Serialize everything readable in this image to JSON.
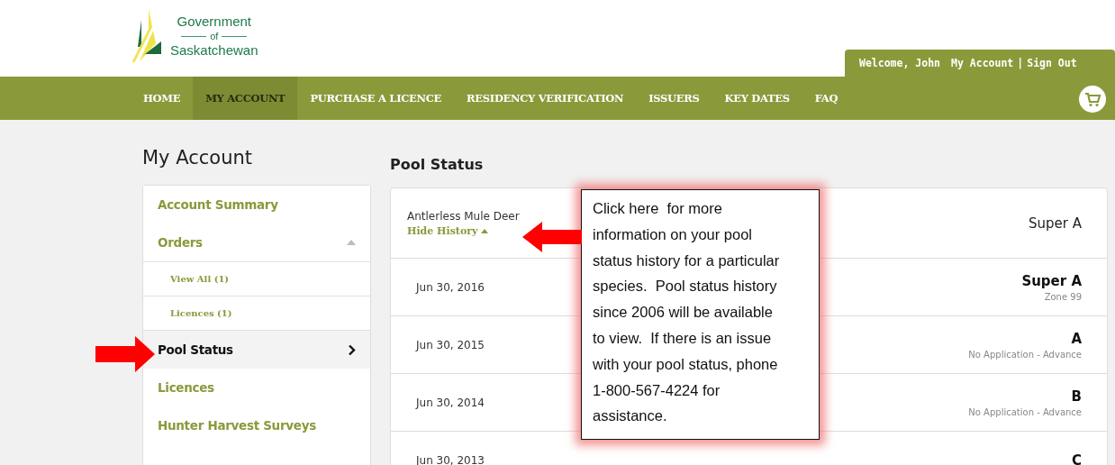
{
  "logo": {
    "line1": "Government",
    "line2": "of",
    "line3": "Saskatchewan"
  },
  "user_bar": {
    "welcome": "Welcome, John",
    "account_link": "My Account",
    "separator": "|",
    "sign_out": "Sign Out"
  },
  "nav": [
    {
      "label": "HOME",
      "selected": false
    },
    {
      "label": "MY ACCOUNT",
      "selected": true
    },
    {
      "label": "PURCHASE A LICENCE",
      "selected": false
    },
    {
      "label": "RESIDENCY VERIFICATION",
      "selected": false
    },
    {
      "label": "ISSUERS",
      "selected": false
    },
    {
      "label": "KEY DATES",
      "selected": false
    },
    {
      "label": "FAQ",
      "selected": false
    }
  ],
  "sidebar": {
    "title": "My Account",
    "items": [
      {
        "label": "Account Summary",
        "kind": "main",
        "selected": false
      },
      {
        "label": "Orders",
        "kind": "main",
        "selected": false,
        "expanded": true,
        "children": [
          {
            "label": "View All (1)",
            "kind": "sub",
            "selected": false
          },
          {
            "label": "Licences (1)",
            "kind": "sub",
            "selected": false
          }
        ]
      },
      {
        "label": "Pool Status",
        "kind": "main",
        "selected": true
      },
      {
        "label": "Licences",
        "kind": "main",
        "selected": false
      },
      {
        "label": "Hunter Harvest Surveys",
        "kind": "main",
        "selected": false
      }
    ]
  },
  "pool_status": {
    "title": "Pool Status",
    "species": "Antlerless Mule Deer",
    "toggle": {
      "label": "Hide History",
      "expanded": true
    },
    "current": "Super A",
    "history": [
      {
        "date": "Jun 30, 2016",
        "status": "Super A",
        "note": "Zone 99"
      },
      {
        "date": "Jun 30, 2015",
        "status": "A",
        "note": "No Application - Advance"
      },
      {
        "date": "Jun 30, 2014",
        "status": "B",
        "note": "No Application - Advance"
      },
      {
        "date": "Jun 30, 2013",
        "status": "C"
      }
    ]
  },
  "callout": {
    "text": "Click here  for more information on your pool status history for a particular species.  Pool status history since 2006 will be available to view.  If there is an issue with your pool status, phone 1-800-567-4224 for assistance."
  }
}
